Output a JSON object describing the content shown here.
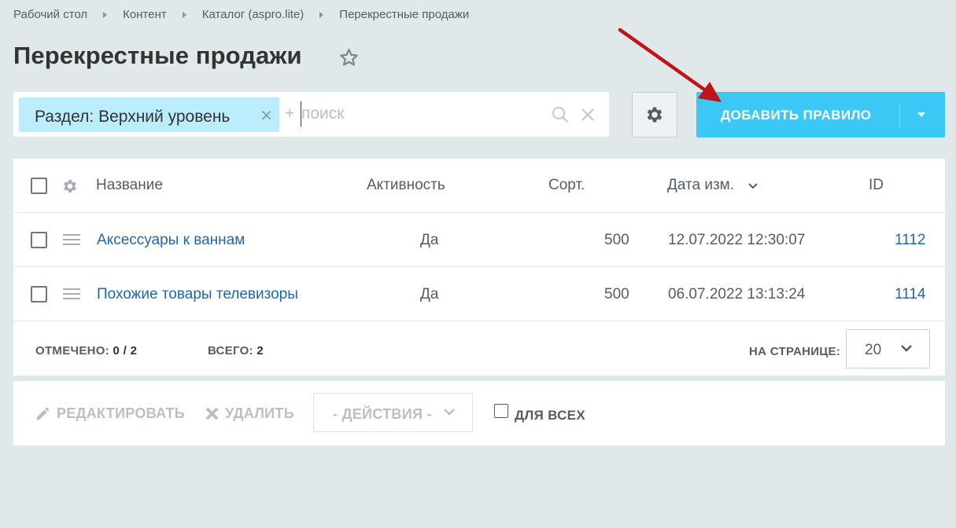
{
  "breadcrumb": [
    {
      "label": "Рабочий стол"
    },
    {
      "label": "Контент"
    },
    {
      "label": "Каталог (aspro.lite)"
    },
    {
      "label": "Перекрестные продажи"
    }
  ],
  "page": {
    "title": "Перекрестные продажи"
  },
  "filter": {
    "tag_label": "Раздел: Верхний уровень",
    "plus": "+",
    "search_placeholder": "поиск",
    "search_value": ""
  },
  "toolbar": {
    "add_label": "ДОБАВИТЬ ПРАВИЛО"
  },
  "grid": {
    "columns": {
      "name": "Название",
      "active": "Активность",
      "sort": "Сорт.",
      "date": "Дата изм.",
      "id": "ID"
    },
    "rows": [
      {
        "name": "Аксессуары к ваннам",
        "active": "Да",
        "sort": "500",
        "date": "12.07.2022 12:30:07",
        "id": "1112"
      },
      {
        "name": "Похожие товары телевизоры",
        "active": "Да",
        "sort": "500",
        "date": "06.07.2022 13:13:24",
        "id": "1114"
      }
    ],
    "footer": {
      "selected_label": "ОТМЕЧЕНО:",
      "selected_value": "0 / 2",
      "total_label": "ВСЕГО:",
      "total_value": "2",
      "per_page_label": "НА СТРАНИЦЕ:",
      "per_page_value": "20"
    }
  },
  "actions": {
    "edit_label": "РЕДАКТИРОВАТЬ",
    "delete_label": "УДАЛИТЬ",
    "actions_select": "- ДЕЙСТВИЯ -",
    "for_all_label": "ДЛЯ ВСЕХ"
  },
  "colors": {
    "background": "#e1e8ea",
    "accent": "#3bc8f5",
    "link": "#2067b0",
    "filter_tag": "#bcedfc",
    "annotation_arrow": "#c0141b"
  }
}
